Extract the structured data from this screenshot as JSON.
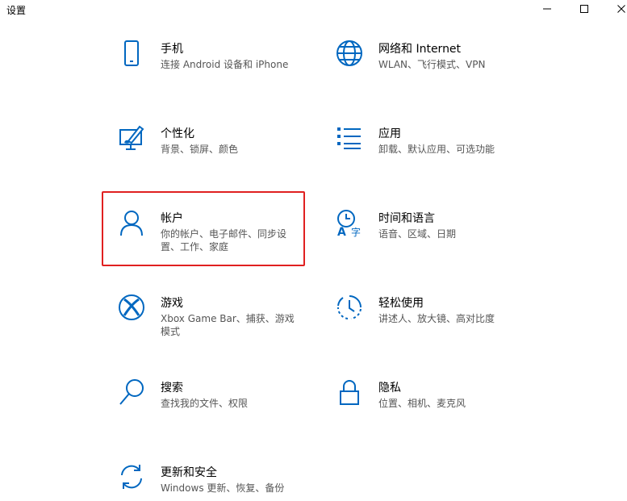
{
  "window": {
    "title": "设置",
    "minimize_icon": "minimize-icon",
    "maximize_icon": "maximize-icon",
    "close_icon": "close-icon"
  },
  "accent_color": "#0067c0",
  "highlight_color": "#e02020",
  "categories": [
    {
      "label": "手机",
      "desc": "连接 Android 设备和 iPhone",
      "icon": "phone-icon"
    },
    {
      "label": "网络和 Internet",
      "desc": "WLAN、飞行模式、VPN",
      "icon": "globe-icon"
    },
    {
      "label": "个性化",
      "desc": "背景、锁屏、颜色",
      "icon": "personalization-icon"
    },
    {
      "label": "应用",
      "desc": "卸载、默认应用、可选功能",
      "icon": "apps-list-icon"
    },
    {
      "label": "帐户",
      "desc": "你的帐户、电子邮件、同步设置、工作、家庭",
      "icon": "person-icon"
    },
    {
      "label": "时间和语言",
      "desc": "语音、区域、日期",
      "icon": "time-language-icon"
    },
    {
      "label": "游戏",
      "desc": "Xbox Game Bar、捕获、游戏模式",
      "icon": "xbox-icon"
    },
    {
      "label": "轻松使用",
      "desc": "讲述人、放大镜、高对比度",
      "icon": "ease-of-access-icon"
    },
    {
      "label": "搜索",
      "desc": "查找我的文件、权限",
      "icon": "search-icon"
    },
    {
      "label": "隐私",
      "desc": "位置、相机、麦克风",
      "icon": "lock-icon"
    },
    {
      "label": "更新和安全",
      "desc": "Windows 更新、恢复、备份",
      "icon": "sync-icon"
    }
  ]
}
